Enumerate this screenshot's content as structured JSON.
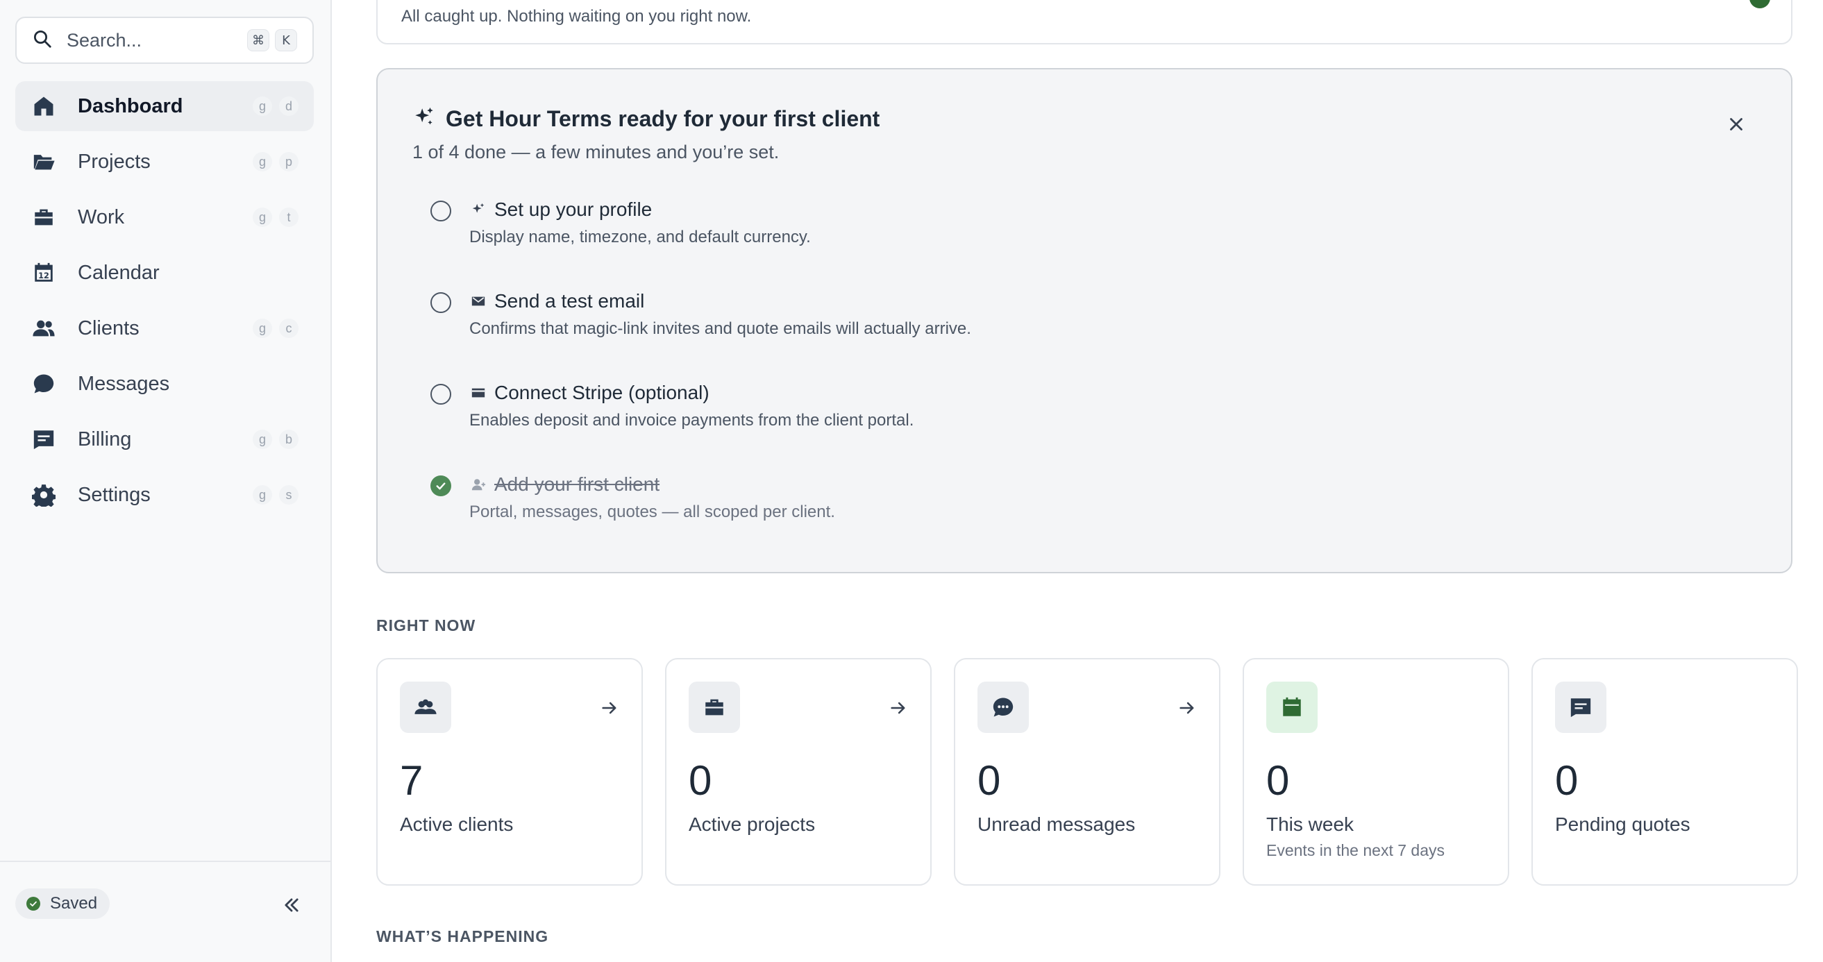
{
  "sidebar": {
    "search": {
      "placeholder": "Search...",
      "shortcut": [
        "⌘",
        "K"
      ]
    },
    "items": [
      {
        "label": "Dashboard",
        "icon": "home-icon",
        "active": true,
        "shortcut": [
          "g",
          "d"
        ]
      },
      {
        "label": "Projects",
        "icon": "folder-icon",
        "shortcut": [
          "g",
          "p"
        ]
      },
      {
        "label": "Work",
        "icon": "briefcase-icon",
        "shortcut": [
          "g",
          "t"
        ]
      },
      {
        "label": "Calendar",
        "icon": "calendar-icon",
        "shortcut": []
      },
      {
        "label": "Clients",
        "icon": "users-icon",
        "shortcut": [
          "g",
          "c"
        ]
      },
      {
        "label": "Messages",
        "icon": "chat-bubble-icon",
        "shortcut": []
      },
      {
        "label": "Billing",
        "icon": "billing-icon",
        "shortcut": [
          "g",
          "b"
        ]
      },
      {
        "label": "Settings",
        "icon": "gear-icon",
        "shortcut": [
          "g",
          "s"
        ]
      }
    ],
    "calendar_day": "12",
    "footer": {
      "saved_label": "Saved"
    }
  },
  "status": {
    "text": "All caught up. Nothing waiting on you right now."
  },
  "onboarding": {
    "title": "Get Hour Terms ready for your first client",
    "subtitle": "1 of 4 done — a few minutes and you’re set.",
    "tasks": [
      {
        "title": "Set up your profile",
        "desc": "Display name, timezone, and default currency.",
        "icon": "sparkle-icon",
        "done": false
      },
      {
        "title": "Send a test email",
        "desc": "Confirms that magic-link invites and quote emails will actually arrive.",
        "icon": "mail-icon",
        "done": false
      },
      {
        "title": "Connect Stripe (optional)",
        "desc": "Enables deposit and invoice payments from the client portal.",
        "icon": "card-icon",
        "done": false
      },
      {
        "title": "Add your first client",
        "desc": "Portal, messages, quotes — all scoped per client.",
        "icon": "user-add-icon",
        "done": true
      }
    ]
  },
  "right_now": {
    "label": "RIGHT NOW",
    "cards": [
      {
        "value": "7",
        "label": "Active clients",
        "icon": "users-icon"
      },
      {
        "value": "0",
        "label": "Active projects",
        "icon": "briefcase-icon"
      },
      {
        "value": "0",
        "label": "Unread messages",
        "icon": "chat-dots-icon"
      },
      {
        "value": "0",
        "label": "This week",
        "extra": "Events in the next 7 days",
        "icon": "calendar-icon",
        "accent": "#2f6b33"
      },
      {
        "value": "0",
        "label": "Pending quotes",
        "icon": "quote-icon"
      }
    ]
  },
  "whats_happening": {
    "label": "WHAT’S HAPPENING"
  },
  "colors": {
    "accent_green": "#2f6b33",
    "sidebar_bg": "#f8f9fa",
    "text_primary": "#1f2a37"
  }
}
